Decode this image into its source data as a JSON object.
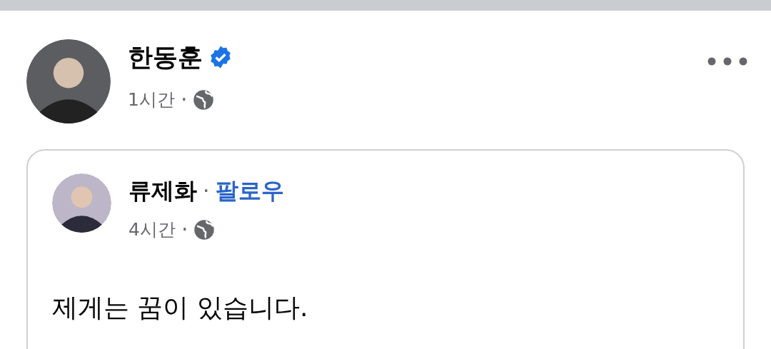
{
  "post": {
    "author": "한동훈",
    "verified": true,
    "time": "1시간",
    "separator": "·"
  },
  "shared_post": {
    "author": "류제화",
    "separator": "·",
    "follow_label": "팔로우",
    "time": "4시간",
    "time_separator": "·",
    "text": "제게는 꿈이 있습니다."
  }
}
